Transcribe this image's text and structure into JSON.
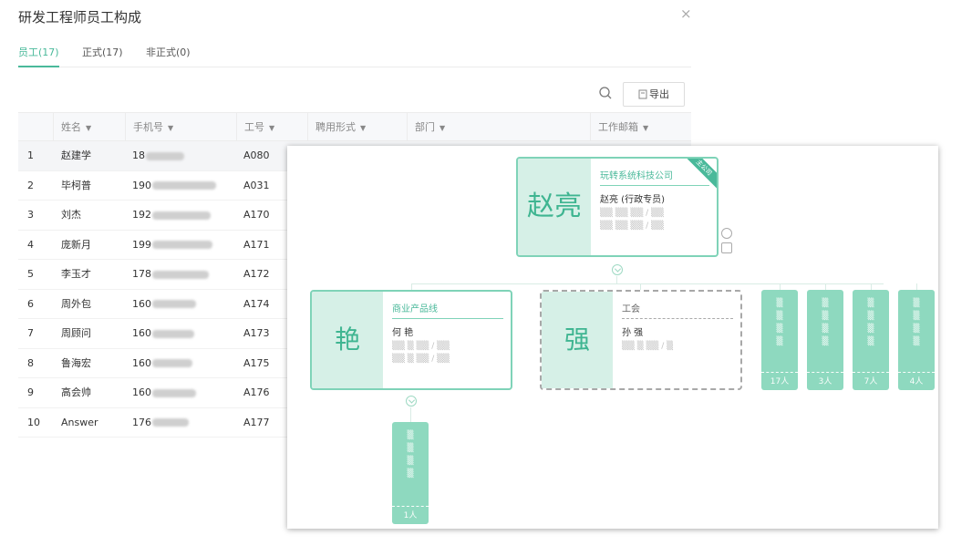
{
  "dialog": {
    "title": "研发工程师员工构成",
    "close": "×",
    "tabs": [
      {
        "label": "员工(17)",
        "active": true
      },
      {
        "label": "正式(17)",
        "active": false
      },
      {
        "label": "非正式(0)",
        "active": false
      }
    ],
    "search_icon": "search-icon",
    "export_label": "导出",
    "table": {
      "columns": [
        "姓名",
        "手机号",
        "工号",
        "聘用形式",
        "部门",
        "工作邮箱"
      ],
      "rows": [
        {
          "idx": "1",
          "name": "赵建学",
          "phone": "18",
          "id": "A080"
        },
        {
          "idx": "2",
          "name": "毕柯普",
          "phone": "190",
          "id": "A031"
        },
        {
          "idx": "3",
          "name": "刘杰",
          "phone": "192",
          "id": "A170"
        },
        {
          "idx": "4",
          "name": "庞新月",
          "phone": "199",
          "id": "A171"
        },
        {
          "idx": "5",
          "name": "李玉才",
          "phone": "178",
          "id": "A172"
        },
        {
          "idx": "6",
          "name": "周外包",
          "phone": "160",
          "id": "A174"
        },
        {
          "idx": "7",
          "name": "周顾问",
          "phone": "160",
          "id": "A173"
        },
        {
          "idx": "8",
          "name": "鲁海宏",
          "phone": "160",
          "id": "A175"
        },
        {
          "idx": "9",
          "name": "高会帅",
          "phone": "160",
          "id": "A176"
        },
        {
          "idx": "10",
          "name": "Answer",
          "phone": "176",
          "id": "A177"
        }
      ]
    }
  },
  "orgchart": {
    "root": {
      "avatar_text": "赵亮",
      "org_name": "玩转系统科技公司",
      "person": "赵亮 (行政专员)",
      "corner": "主公司"
    },
    "child_left": {
      "avatar_text": "艳",
      "org_name": "商业产品线",
      "person": "何 艳"
    },
    "child_mid": {
      "avatar_text": "强",
      "org_name": "工会",
      "person": "孙 强"
    },
    "columns": [
      {
        "count": "17人"
      },
      {
        "count": "3人"
      },
      {
        "count": "7人"
      },
      {
        "count": "4人"
      }
    ],
    "sub_column": {
      "count": "1人"
    }
  }
}
